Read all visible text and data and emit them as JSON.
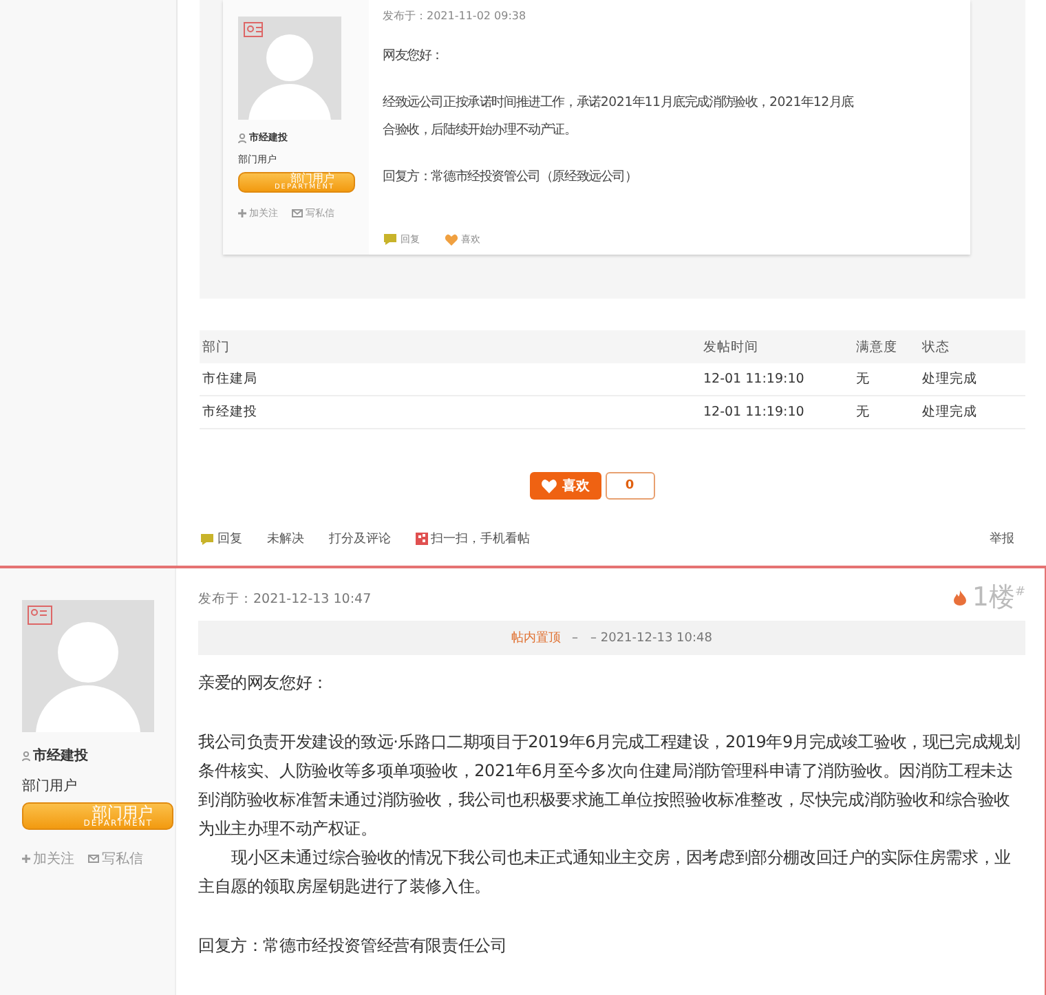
{
  "first_post": {
    "author": {
      "name": "市经建投",
      "role": "部门用户",
      "badge_title": "部门用户",
      "badge_subtitle": "DEPARTMENT",
      "follow": "加关注",
      "message": "写私信"
    },
    "posted": "发布于：2021-11-02 09:38",
    "paragraphs": [
      "网友您好：",
      "经致远公司正按承诺时间推进工作，承诺2021年11月底完成消防验收，2021年12月底",
      "合验收，后陆续开始办理不动产证。",
      "回复方：常德市经投资管公司（原经致远公司）"
    ],
    "actions": [
      {
        "kind": "reply",
        "label": "回复"
      },
      {
        "kind": "like",
        "label": "喜欢"
      }
    ]
  },
  "department_table": {
    "columns": [
      "部门",
      "发帖时间",
      "满意度",
      "状态"
    ],
    "rows": [
      [
        "市住建局",
        "12-01 11:19:10",
        "无",
        "处理完成"
      ],
      [
        "市经建投",
        "12-01 11:19:10",
        "无",
        "处理完成"
      ]
    ]
  },
  "like": {
    "label": "喜欢",
    "count": "0"
  },
  "action_bar": [
    {
      "kind": "reply",
      "label": "回复"
    },
    {
      "kind": "plain",
      "label": "未解决"
    },
    {
      "kind": "plain",
      "label": "打分及评论"
    },
    {
      "kind": "qr",
      "label": "扫一扫，手机看帖"
    },
    {
      "kind": "report",
      "label": "举报"
    }
  ],
  "second_post": {
    "author": {
      "name": "市经建投",
      "role": "部门用户",
      "badge_title": "部门用户",
      "badge_subtitle": "DEPARTMENT",
      "follow": "加关注",
      "message": "写私信"
    },
    "posted": "发布于：2021-12-13 10:47",
    "floor": "1楼$^{#}$",
    "sticky": {
      "label": "帖内置顶",
      "detail": "–　– 2021-12-13 10:48"
    },
    "paragraphs": [
      {
        "text": "亲爱的网友您好：",
        "indent": false,
        "gap": true
      },
      {
        "text": "我公司负责开发建设的致远·乐路口二期项目于2019年6月完成工程建设，2019年9月完成竣工验收，现已完成规划条件核实、人防验收等多项单项验收，2021年6月至今多次向住建局消防管理科申请了消防验收。因消防工程未达到消防验收标准暂未通过消防验收，我公司也积极要求施工单位按照验收标准整改，尽快完成消防验收和综合验收为业主办理不动产权证。",
        "indent": false,
        "gap": false
      },
      {
        "text": "现小区未通过综合验收的情况下我公司也未正式通知业主交房，因考虑到部分棚改回迁户的实际住房需求，业主自愿的领取房屋钥匙进行了装修入住。",
        "indent": true,
        "gap": true
      },
      {
        "text": "回复方：常德市经投资管经营有限责任公司",
        "indent": false,
        "gap": false
      }
    ]
  }
}
